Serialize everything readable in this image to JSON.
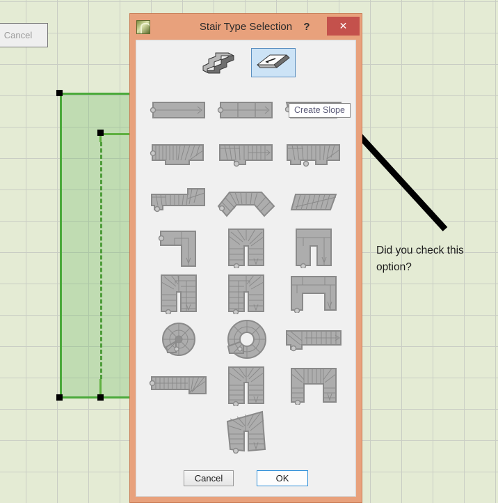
{
  "background": {
    "name": "cad-canvas",
    "grid_color": "#c9cdc4",
    "fill_color": "#e4ebd4",
    "cancel_button_label": "Cancel",
    "selection": {
      "outline_color": "#4aa93a",
      "fill_color": "rgba(110,186,100,0.30)",
      "node_count": 4
    }
  },
  "annotation": {
    "text_line_1": "Did you check this",
    "text_line_2": "option?",
    "arrow_color": "#000000",
    "arrow_from": "640,328",
    "arrow_to": "420,92"
  },
  "dialog": {
    "title": "Stair Type Selection",
    "frame_color": "#e8a17c",
    "app_icon": "archicad-app-icon",
    "help_label": "?",
    "close_label": "✕",
    "tooltip": "Create Slope",
    "modes": [
      {
        "name": "create-stair",
        "label": "Create Stair",
        "selected": false
      },
      {
        "name": "create-slope",
        "label": "Create Slope",
        "selected": true
      }
    ],
    "buttons": {
      "cancel": "Cancel",
      "ok": "OK"
    },
    "thumbnails": [
      {
        "name": "straight-slope-single",
        "type": "straight-plain"
      },
      {
        "name": "straight-slope-segments",
        "type": "straight-3seg"
      },
      {
        "name": "straight-tapered-treads",
        "type": "tapered-wide"
      },
      {
        "name": "straight-winder-right-end",
        "type": "winder-right"
      },
      {
        "name": "straight-winder-center",
        "type": "winder-center"
      },
      {
        "name": "straight-winder-both-ends",
        "type": "winder-both"
      },
      {
        "name": "straight-with-landing-right",
        "type": "landing-right"
      },
      {
        "name": "angled-v-stair",
        "type": "v-shape"
      },
      {
        "name": "skewed-parallelogram-stair",
        "type": "skewed"
      },
      {
        "name": "l-shaped-stair",
        "type": "l-shape"
      },
      {
        "name": "u-shaped-winder-stair",
        "type": "u-winder"
      },
      {
        "name": "u-shaped-landing-stair",
        "type": "u-landing"
      },
      {
        "name": "u-shaped-quarter-winder-left",
        "type": "u-quarter-left"
      },
      {
        "name": "u-shaped-quarter-winder-right",
        "type": "u-quarter-right"
      },
      {
        "name": "u-shaped-wide-landing",
        "type": "u-wide"
      },
      {
        "name": "spiral-stair-solid-core",
        "type": "spiral-solid"
      },
      {
        "name": "spiral-stair-open-well",
        "type": "spiral-open"
      },
      {
        "name": "straight-with-corner-winder",
        "type": "corner-winder"
      },
      {
        "name": "long-straight-with-winder-end",
        "type": "long-winder-end"
      },
      {
        "name": "u-shaped-winder-top",
        "type": "u-winder-top"
      },
      {
        "name": "u-shaped-double-corner-winder",
        "type": "u-double-winder"
      },
      {
        "name": "flared-u-shaped-stair",
        "type": "flared-u"
      }
    ]
  }
}
